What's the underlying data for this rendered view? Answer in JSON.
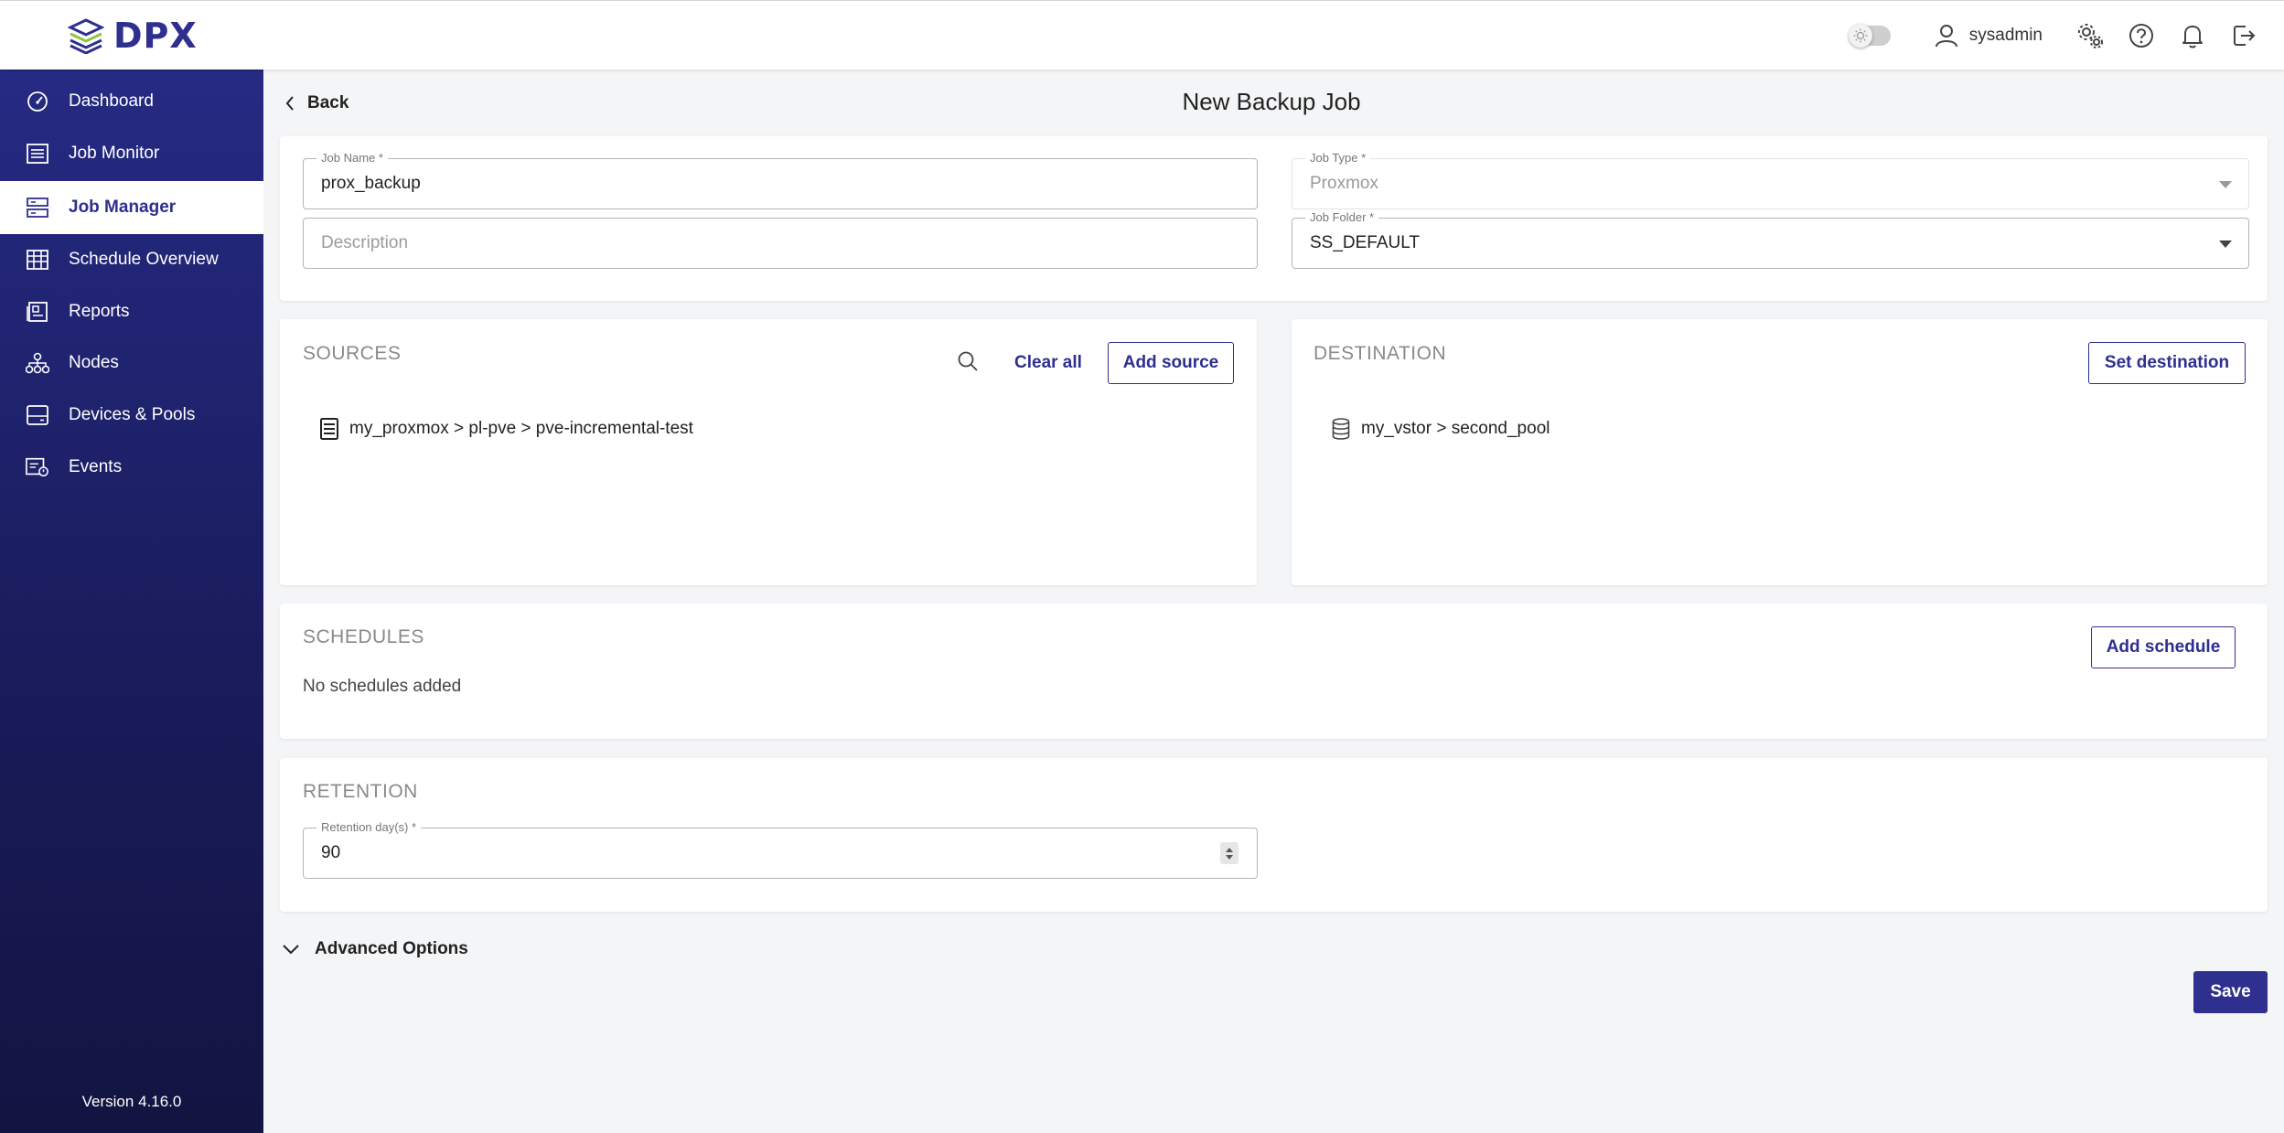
{
  "app": {
    "logo_text": "DPX"
  },
  "header": {
    "username": "sysadmin"
  },
  "sidebar": {
    "items": [
      {
        "label": "Dashboard",
        "icon": "dashboard-gauge-icon"
      },
      {
        "label": "Job Monitor",
        "icon": "list-icon"
      },
      {
        "label": "Job Manager",
        "icon": "server-list-icon",
        "active": true
      },
      {
        "label": "Schedule Overview",
        "icon": "calendar-grid-icon"
      },
      {
        "label": "Reports",
        "icon": "report-icon"
      },
      {
        "label": "Nodes",
        "icon": "nodes-icon"
      },
      {
        "label": "Devices & Pools",
        "icon": "storage-device-icon"
      },
      {
        "label": "Events",
        "icon": "events-icon"
      }
    ],
    "version": "Version 4.16.0"
  },
  "page": {
    "back_label": "Back",
    "title": "New Backup Job"
  },
  "form": {
    "job_name": {
      "label": "Job Name *",
      "value": "prox_backup"
    },
    "description": {
      "placeholder": "Description"
    },
    "job_type": {
      "label": "Job Type *",
      "value": "Proxmox"
    },
    "job_folder": {
      "label": "Job Folder *",
      "value": "SS_DEFAULT"
    }
  },
  "sources": {
    "title": "SOURCES",
    "clear_all": "Clear all",
    "add_source": "Add source",
    "items": [
      "my_proxmox > pl-pve > pve-incremental-test"
    ]
  },
  "destination": {
    "title": "DESTINATION",
    "set_destination": "Set destination",
    "items": [
      "my_vstor > second_pool"
    ]
  },
  "schedules": {
    "title": "SCHEDULES",
    "add_schedule": "Add schedule",
    "empty_text": "No schedules added"
  },
  "retention": {
    "title": "RETENTION",
    "label": "Retention day(s) *",
    "value": "90"
  },
  "advanced": {
    "label": "Advanced Options"
  },
  "actions": {
    "save": "Save"
  },
  "colors": {
    "brand": "#2e2f8f",
    "sidebar_top": "#262a83",
    "sidebar_bottom": "#121441",
    "logo_accent_green": "#8cc63f"
  }
}
